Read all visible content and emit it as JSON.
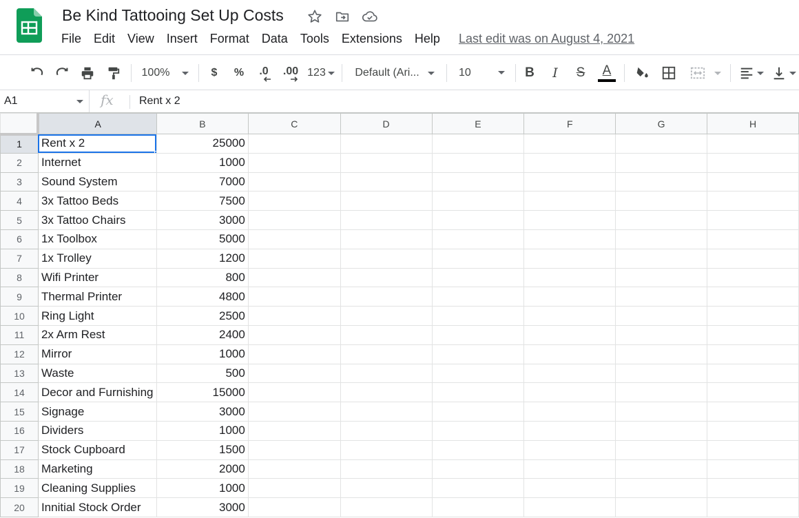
{
  "doc": {
    "title": "Be Kind Tattooing Set Up Costs",
    "last_edit": "Last edit was on August 4, 2021"
  },
  "icons": {
    "logo": "google-sheets-logo",
    "star": "star-icon",
    "move": "move-to-folder-icon",
    "cloud": "cloud-saved-icon"
  },
  "menu": [
    "File",
    "Edit",
    "View",
    "Insert",
    "Format",
    "Data",
    "Tools",
    "Extensions",
    "Help"
  ],
  "toolbar": {
    "zoom": "100%",
    "currency": "$",
    "percent": "%",
    "dec_decrease": ".0",
    "dec_increase": ".00",
    "more_formats": "123",
    "font": "Default (Ari...",
    "font_size": "10",
    "bold": "B",
    "italic": "I",
    "strike": "S",
    "text_color": "A"
  },
  "formula": {
    "cell_ref": "A1",
    "fx": "fx",
    "content": "Rent x 2"
  },
  "columns": [
    "A",
    "B",
    "C",
    "D",
    "E",
    "F",
    "G",
    "H"
  ],
  "rows": [
    {
      "n": "1",
      "a": "Rent x 2",
      "b": "25000"
    },
    {
      "n": "2",
      "a": "Internet",
      "b": "1000"
    },
    {
      "n": "3",
      "a": "Sound System",
      "b": "7000"
    },
    {
      "n": "4",
      "a": "3x Tattoo Beds",
      "b": "7500"
    },
    {
      "n": "5",
      "a": "3x Tattoo Chairs",
      "b": "3000"
    },
    {
      "n": "6",
      "a": "1x Toolbox",
      "b": "5000"
    },
    {
      "n": "7",
      "a": "1x Trolley",
      "b": "1200"
    },
    {
      "n": "8",
      "a": "Wifi Printer",
      "b": "800"
    },
    {
      "n": "9",
      "a": "Thermal Printer",
      "b": "4800"
    },
    {
      "n": "10",
      "a": "Ring Light",
      "b": "2500"
    },
    {
      "n": "11",
      "a": "2x Arm Rest",
      "b": "2400"
    },
    {
      "n": "12",
      "a": "Mirror",
      "b": "1000"
    },
    {
      "n": "13",
      "a": "Waste",
      "b": "500"
    },
    {
      "n": "14",
      "a": "Decor and Furnishing",
      "b": "15000"
    },
    {
      "n": "15",
      "a": "Signage",
      "b": "3000"
    },
    {
      "n": "16",
      "a": "Dividers",
      "b": "1000"
    },
    {
      "n": "17",
      "a": "Stock Cupboard",
      "b": "1500"
    },
    {
      "n": "18",
      "a": "Marketing",
      "b": "2000"
    },
    {
      "n": "19",
      "a": "Cleaning Supplies",
      "b": "1000"
    },
    {
      "n": "20",
      "a": "Innitial Stock Order",
      "b": "3000"
    }
  ],
  "colors": {
    "selection": "#1a73e8",
    "logo_green": "#0f9d58"
  }
}
